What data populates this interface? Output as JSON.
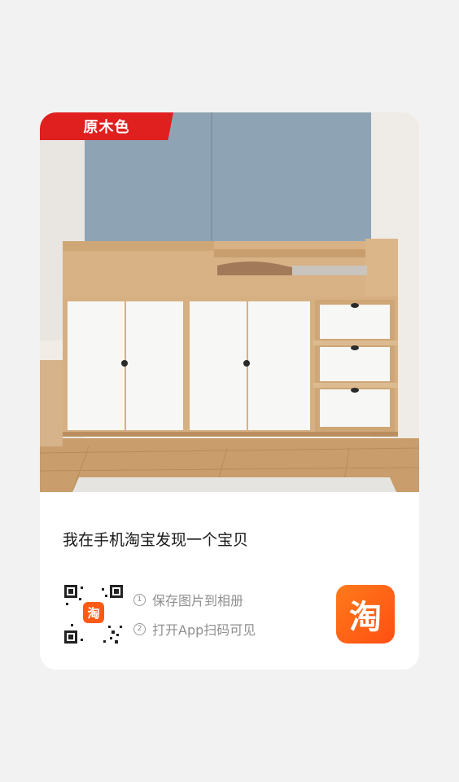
{
  "card": {
    "badge_label": "原木色",
    "share_title": "我在手机淘宝发现一个宝贝"
  },
  "steps": [
    {
      "number": "1",
      "label": "保存图片到相册"
    },
    {
      "number": "2",
      "label": "打开App扫码可见"
    }
  ],
  "qr": {
    "center_logo_text": "淘"
  },
  "app_logo": {
    "text": "淘",
    "color": "#ff5a14"
  },
  "colors": {
    "badge": "#e01f1f",
    "wall": "#8ea4b5",
    "wood": "#d7b184",
    "door": "#f7f7f5"
  }
}
